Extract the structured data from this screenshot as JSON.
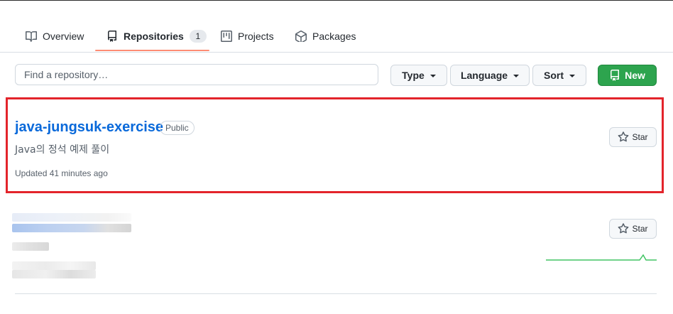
{
  "tabs": [
    {
      "label": "Overview",
      "icon": "book-icon"
    },
    {
      "label": "Repositories",
      "icon": "repo-icon",
      "count": "1"
    },
    {
      "label": "Projects",
      "icon": "project-icon"
    },
    {
      "label": "Packages",
      "icon": "package-icon"
    }
  ],
  "filters": {
    "search_placeholder": "Find a repository…",
    "type_label": "Type",
    "language_label": "Language",
    "sort_label": "Sort",
    "new_label": "New"
  },
  "repos": [
    {
      "name": "java-jungsuk-exercise",
      "visibility": "Public",
      "description": "Java의 정석 예제 풀이",
      "updated": "Updated 41 minutes ago",
      "star_label": "Star"
    },
    {
      "star_label": "Star",
      "blurred": true
    }
  ],
  "colors": {
    "link": "#0969da",
    "primary_button": "#2da44e",
    "tab_underline": "#fd8c73",
    "highlight_box": "#e3242b",
    "sparkline": "#40c463"
  }
}
